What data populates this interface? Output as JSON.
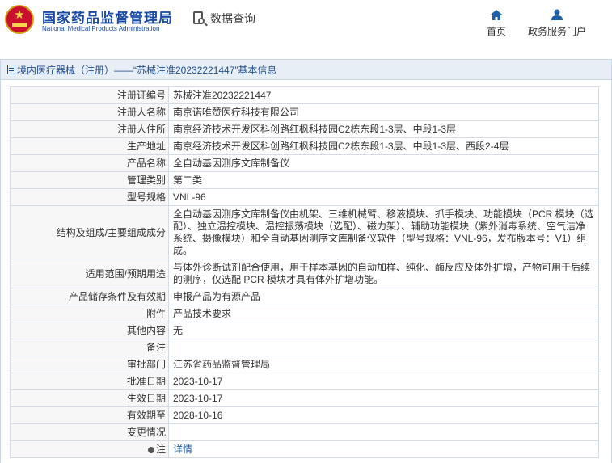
{
  "header": {
    "brand_cn": "国家药品监督管理局",
    "brand_en": "National Medical Products Administration",
    "query_label": "数据查询",
    "nav": {
      "home": "首页",
      "service": "政务服务门户"
    }
  },
  "panel": {
    "title": "境内医疗器械（注册）——“苏械注准20232221447”基本信息"
  },
  "rows": [
    {
      "key": "注册证编号",
      "value": "苏械注准20232221447"
    },
    {
      "key": "注册人名称",
      "value": "南京诺唯赞医疗科技有限公司"
    },
    {
      "key": "注册人住所",
      "value": "南京经济技术开发区科创路红枫科技园C2栋东段1-3层、中段1-3层"
    },
    {
      "key": "生产地址",
      "value": "南京经济技术开发区科创路红枫科技园C2栋东段1-3层、中段1-3层、西段2-4层"
    },
    {
      "key": "产品名称",
      "value": "全自动基因测序文库制备仪"
    },
    {
      "key": "管理类别",
      "value": "第二类"
    },
    {
      "key": "型号规格",
      "value": "VNL-96"
    },
    {
      "key": "结构及组成/主要组成成分",
      "value": "全自动基因测序文库制备仪由机架、三维机械臂、移液模块、抓手模块、功能模块（PCR 模块（选配）、独立温控模块、温控振荡模块（选配）、磁力架）、辅助功能模块（紫外消毒系统、空气洁净系统、摄像模块）和全自动基因测序文库制备仪软件（型号规格：VNL-96，发布版本号：V1）组成。"
    },
    {
      "key": "适用范围/预期用途",
      "value": "与体外诊断试剂配合使用，用于样本基因的自动加样、纯化、酶反应及体外扩增，产物可用于后续的测序，仅选配 PCR 模块才具有体外扩增功能。"
    },
    {
      "key": "产品储存条件及有效期",
      "value": "申报产品为有源产品"
    },
    {
      "key": "附件",
      "value": "产品技术要求"
    },
    {
      "key": "其他内容",
      "value": "无"
    },
    {
      "key": "备注",
      "value": ""
    },
    {
      "key": "审批部门",
      "value": "江苏省药品监督管理局"
    },
    {
      "key": "批准日期",
      "value": "2023-10-17"
    },
    {
      "key": "生效日期",
      "value": "2023-10-17"
    },
    {
      "key": "有效期至",
      "value": "2028-10-16"
    },
    {
      "key": "变更情况",
      "value": ""
    },
    {
      "key": "注",
      "value": "详情"
    }
  ],
  "colors": {
    "brand": "#1a4aa6",
    "link": "#1f5ea8",
    "panel_header": "#e8eef6"
  }
}
